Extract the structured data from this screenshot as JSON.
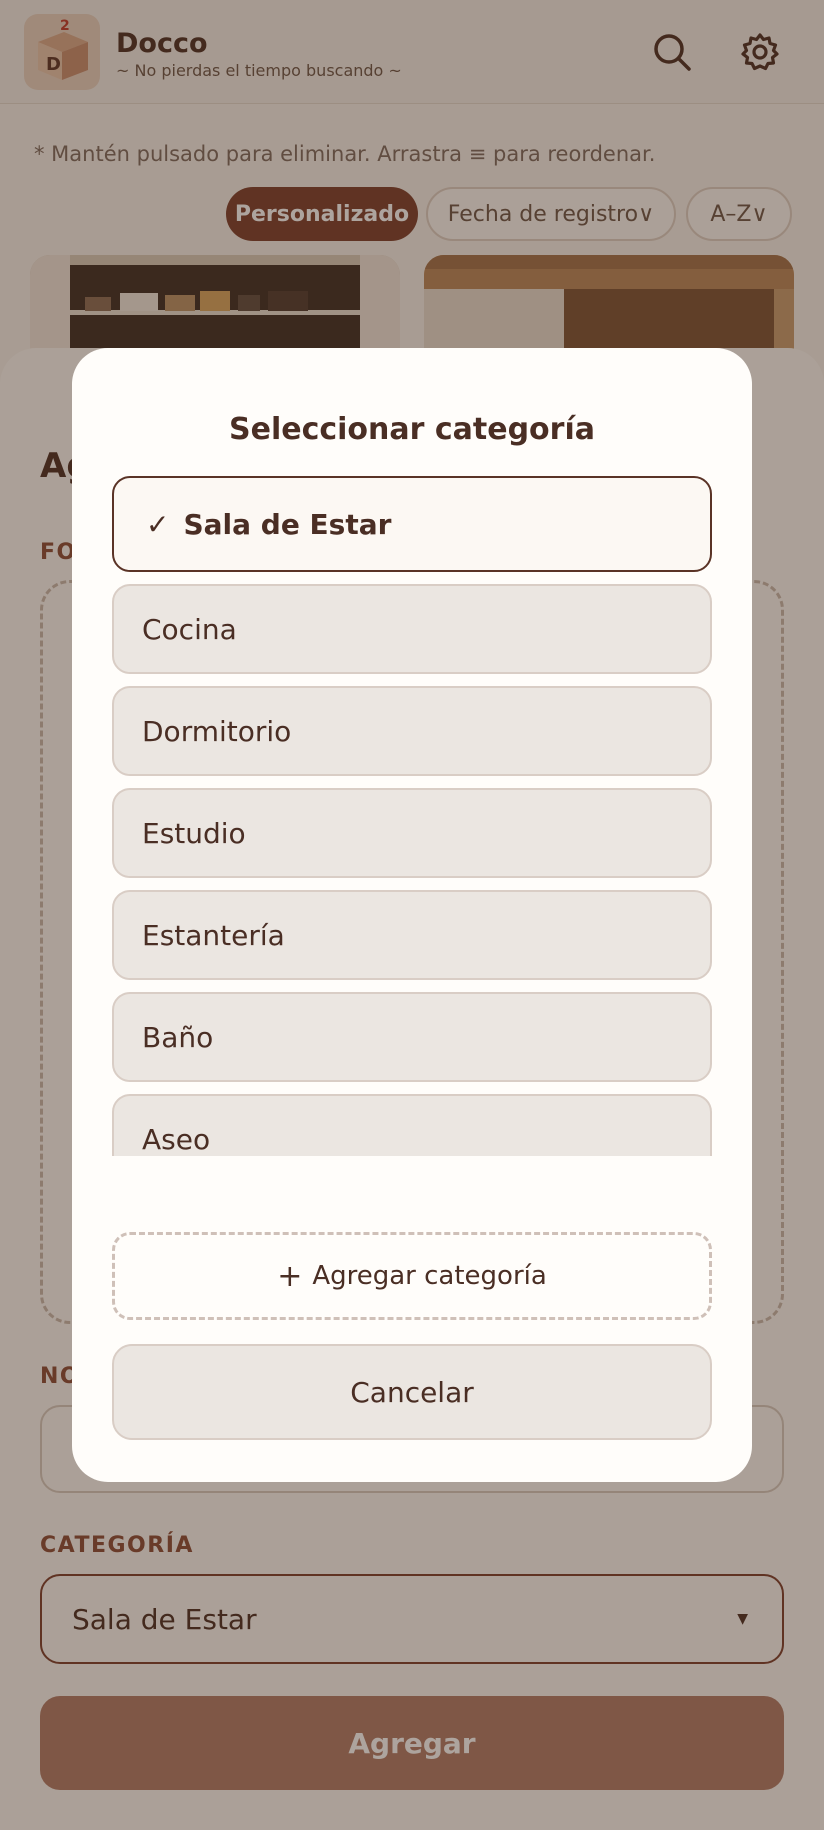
{
  "header": {
    "app_name": "Docco",
    "tagline": "~ No pierdas el tiempo buscando ~",
    "logo_letter": "D",
    "logo_number": "2",
    "icons": [
      "search-icon",
      "gear-icon"
    ]
  },
  "page": {
    "hint": "* Mantén pulsado para eliminar. Arrastra ≡ para reordenar.",
    "sort_chips": {
      "custom": "Personalizado",
      "date": "Fecha de registro∨",
      "az": "A–Z∨"
    }
  },
  "add_sheet": {
    "title_visible": "Ag",
    "photo_label_visible": "FO",
    "name_label_visible": "NO",
    "category_label": "CATEGORÍA",
    "category_value": "Sala de Estar",
    "caret": "▼",
    "add_button": "Agregar"
  },
  "modal": {
    "title": "Seleccionar categoría",
    "check": "✓",
    "options": [
      {
        "label": "Sala de Estar",
        "selected": true
      },
      {
        "label": "Cocina",
        "selected": false
      },
      {
        "label": "Dormitorio",
        "selected": false
      },
      {
        "label": "Estudio",
        "selected": false
      },
      {
        "label": "Estantería",
        "selected": false
      },
      {
        "label": "Baño",
        "selected": false
      },
      {
        "label": "Aseo",
        "selected": false
      }
    ],
    "add_category": "Agregar categoría",
    "add_category_icon": "+",
    "cancel": "Cancelar"
  },
  "colors": {
    "accent": "#7a3d2c",
    "text": "#4a2e24",
    "background": "#f6f2ec",
    "overlay": "rgba(60,38,24,0.42)"
  }
}
